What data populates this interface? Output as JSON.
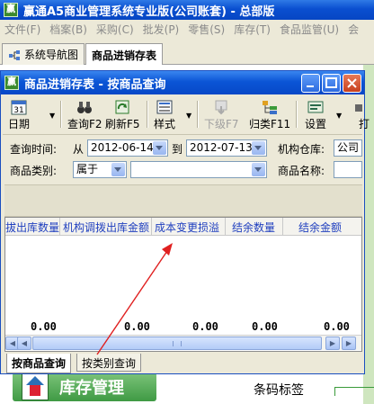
{
  "app": {
    "title": "赢通A5商业管理系统专业版(公司账套) - 总部版",
    "logo": "赢"
  },
  "menu": [
    "文件(F)",
    "档案(B)",
    "采购(C)",
    "批发(P)",
    "零售(S)",
    "库存(T)",
    "食品监管(U)",
    "会"
  ],
  "main_tabs": [
    {
      "label": "系统导航图",
      "icon": "navigation-map-icon"
    },
    {
      "label": "商品进销存表",
      "icon": ""
    }
  ],
  "window": {
    "title": "商品进销存表 - 按商品查询",
    "logo": "赢"
  },
  "toolbar": [
    {
      "label": "日期",
      "icon": "calendar-icon",
      "dropdown": true
    },
    {
      "label": "查询F2",
      "icon": "binoculars-icon"
    },
    {
      "label": "刷新F5",
      "icon": "refresh-icon"
    },
    {
      "label": "样式",
      "icon": "style-icon",
      "dropdown": true
    },
    {
      "label": "下级F7",
      "icon": "down-level-icon",
      "disabled": true
    },
    {
      "label": "归类F11",
      "icon": "category-icon"
    },
    {
      "label": "设置",
      "icon": "settings-icon",
      "dropdown": true
    },
    {
      "label": "打",
      "icon": "print-icon"
    }
  ],
  "query": {
    "time_label": "查询时间:",
    "from_label": "从",
    "from_date": "2012-06-14",
    "to_label": "到",
    "to_date": "2012-07-13",
    "warehouse_label": "机构仓库:",
    "warehouse_value": "公司",
    "category_label": "商品类别:",
    "category_mode": "属于",
    "category_value": "",
    "product_name_label": "商品名称:",
    "product_name_value": ""
  },
  "grid": {
    "columns": [
      "拔出库数量",
      "机构调拨出库金额",
      "成本变更损溢",
      "结余数量",
      "结余金额"
    ],
    "totals": [
      "0.00",
      "0.00",
      "0.00",
      "0.00",
      "0.00"
    ]
  },
  "bottom_tabs": [
    "按商品查询",
    "按类别查询"
  ],
  "background": {
    "stock_button": "库存管理",
    "barcode_label": "条码标签"
  },
  "colors": {
    "title_bar": "#0a4fd0",
    "grid_header_text": "#1f3fbf",
    "annotation_arrow": "#e02020",
    "stock_button": "#3f9a44"
  }
}
